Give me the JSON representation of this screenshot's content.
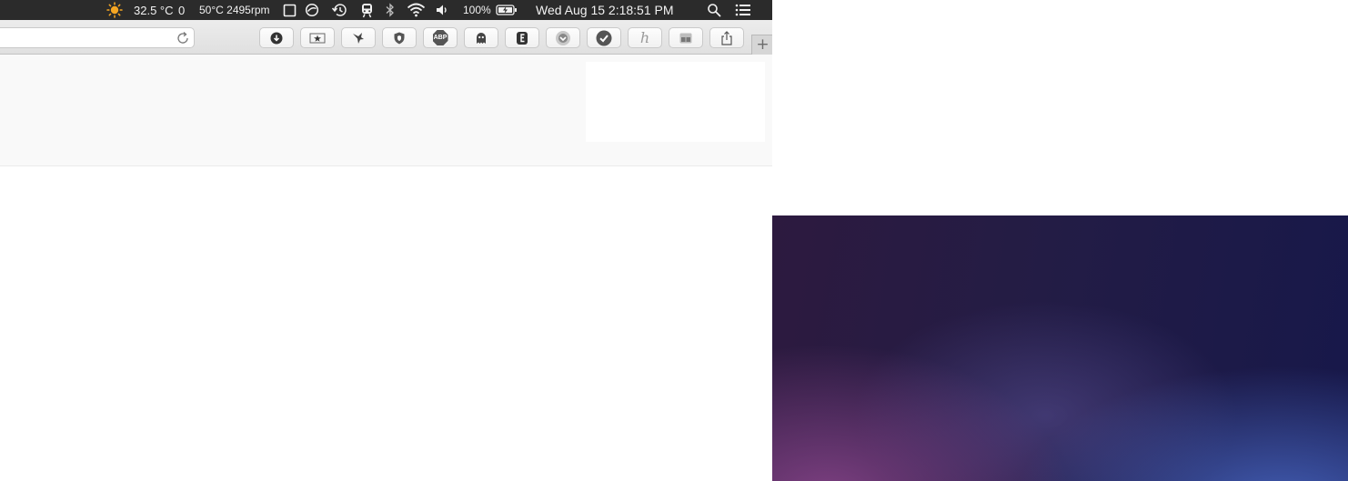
{
  "menubar": {
    "weather_icon": "sun-icon",
    "temperature": "32.5 °C",
    "counter": "0",
    "cpu_stats": "50°C 2495rpm",
    "battery_percent": "100%",
    "datetime": "Wed Aug 15  2:18:51 PM",
    "icons": [
      "window-icon",
      "sync-icon",
      "time-machine-icon",
      "train-icon",
      "bluetooth-icon",
      "wifi-icon",
      "volume-icon",
      "battery-charging-icon",
      "spotlight-search-icon",
      "notification-center-icon"
    ]
  },
  "toolbar": {
    "address_value": "",
    "reload_icon": "reload-icon",
    "extensions": [
      {
        "name": "downloads-icon"
      },
      {
        "name": "bookmark-star-icon"
      },
      {
        "name": "bird-extension-icon"
      },
      {
        "name": "shield-extension-icon"
      },
      {
        "name": "adblock-plus-icon",
        "label": "ABP"
      },
      {
        "name": "ghostery-icon"
      },
      {
        "name": "evernote-icon"
      },
      {
        "name": "pocket-extension-icon"
      },
      {
        "name": "checkmark-extension-icon"
      },
      {
        "name": "honey-extension-icon",
        "label": "h"
      },
      {
        "name": "tab-grid-icon"
      },
      {
        "name": "share-icon"
      }
    ],
    "new_tab_label": "+"
  },
  "colors": {
    "menubar_bg": "#2b2b2b",
    "toolbar_bg": "#e4e4e4",
    "content_bg": "#f9f9f9",
    "wallpaper_dark": "#231c45",
    "wallpaper_blue": "#4664be",
    "wallpaper_purple": "#8c468c",
    "sun_orange": "#f5a623"
  }
}
